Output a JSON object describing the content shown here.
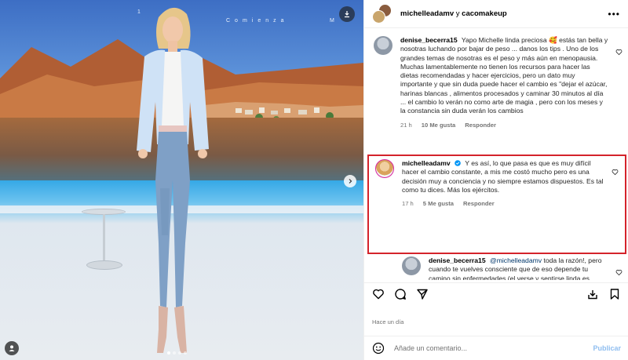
{
  "photo": {
    "overlay_words": [
      "Comienza",
      "M",
      "1"
    ],
    "carousel_dots": 4,
    "active_dot": 0
  },
  "header": {
    "user1": "michelleadamv",
    "connector": "y",
    "user2": "cacomakeup"
  },
  "comments": [
    {
      "user": "denise_becerra15",
      "text": "Yapo Michelle linda preciosa 🥰 estás tan bella y nosotras luchando por bajar de peso ... danos los tips . Uno de los grandes temas de nosotras es el peso y más aún en menopausia. Muchas lamentablemente no tienen los recursos para hacer las dietas recomendadas y hacer ejercicios, pero un dato muy importante y que sin duda puede hacer el cambio es \"dejar el azúcar, harinas blancas , alimentos procesados y caminar 30 minutos al día ... el cambio lo verán no como arte de magia , pero con los meses y la constancia sin duda verán los cambios",
      "time": "21 h",
      "likes": "10 Me gusta",
      "reply": "Responder"
    },
    {
      "user": "michelleadamv",
      "verified": true,
      "text": "Y es así, lo que pasa es que es muy difícil hacer el cambio constante, a mis me costó mucho pero es una decisión muy a conciencia y no siempre estamos dispuestos. Es tal como tu dices. Más los ejércitos.",
      "time": "17 h",
      "likes": "5 Me gusta",
      "reply": "Responder"
    },
    {
      "user": "denise_becerra15",
      "mention": "@michelleadamv",
      "text": "toda la razón!, pero cuando te vuelves consciente que de eso depende tu camino sin enfermedades,(el verse y sentirse linda es añadidura)sin duda solo continúan días llenos de querer aprender y de motivación ."
    }
  ],
  "footer": {
    "time_ago": "Hace un día",
    "comment_placeholder": "Añade un comentario...",
    "publish_label": "Publicar"
  },
  "colors": {
    "highlight_border": "#d4232b",
    "link": "#00376b",
    "publish": "#8fbef0",
    "verified": "#0095f6"
  }
}
